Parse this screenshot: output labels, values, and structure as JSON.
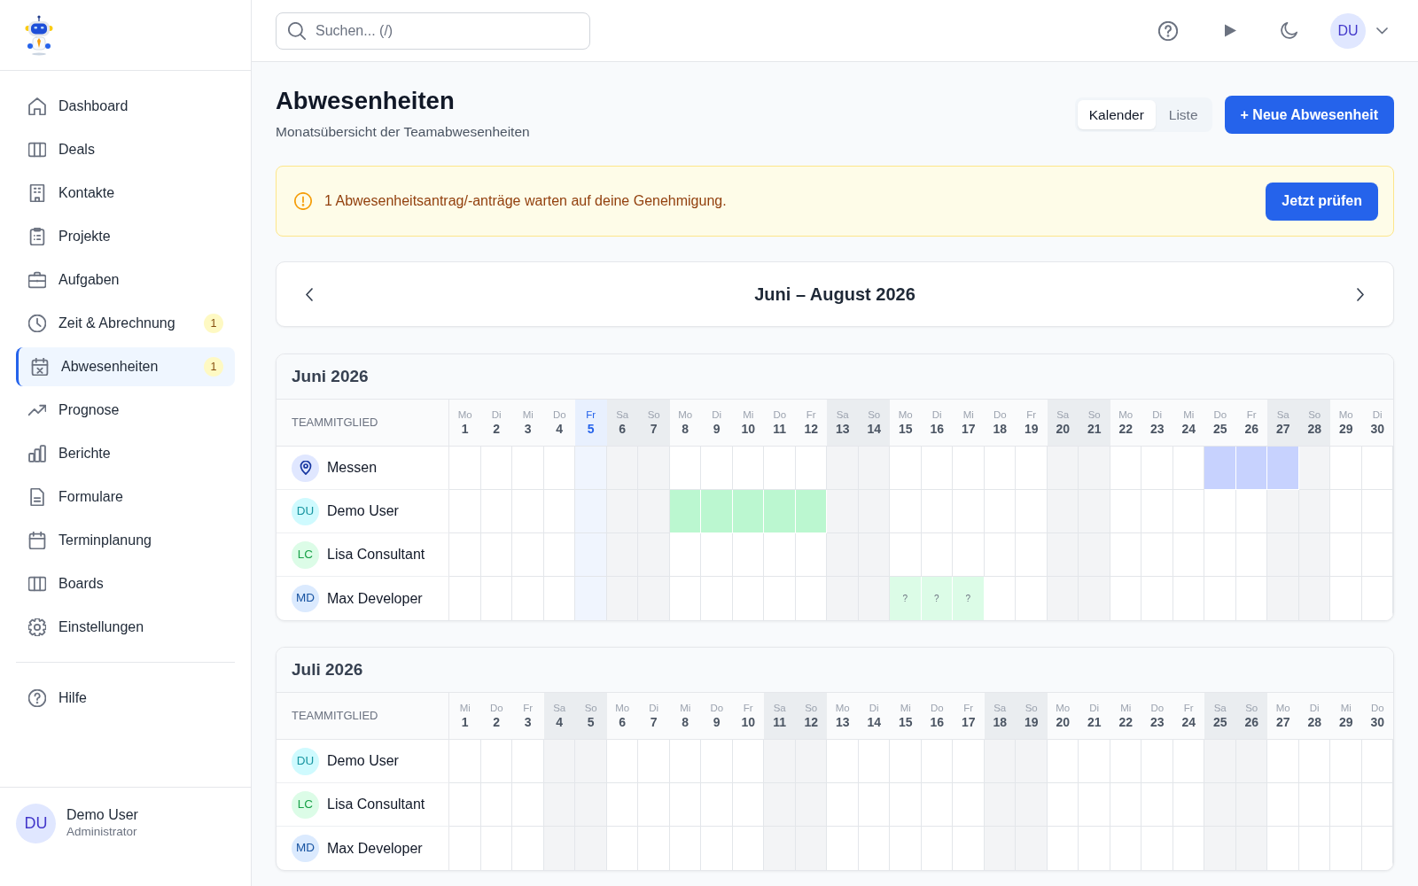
{
  "sidebar": {
    "items": [
      {
        "label": "Dashboard",
        "selected": false
      },
      {
        "label": "Deals",
        "selected": false
      },
      {
        "label": "Kontakte",
        "selected": false
      },
      {
        "label": "Projekte",
        "selected": false
      },
      {
        "label": "Aufgaben",
        "selected": false
      },
      {
        "label": "Zeit & Abrechnung",
        "selected": false,
        "badge": "1"
      },
      {
        "label": "Abwesenheiten",
        "selected": true,
        "badge": "1"
      },
      {
        "label": "Prognose",
        "selected": false
      },
      {
        "label": "Berichte",
        "selected": false
      },
      {
        "label": "Formulare",
        "selected": false
      },
      {
        "label": "Terminplanung",
        "selected": false
      },
      {
        "label": "Boards",
        "selected": false
      },
      {
        "label": "Einstellungen",
        "selected": false
      }
    ],
    "footer_items": [
      {
        "label": "Hilfe",
        "selected": false
      }
    ],
    "user": {
      "initials": "DU",
      "name": "Demo User",
      "role": "Administrator"
    }
  },
  "topbar": {
    "search": {
      "placeholder": "Suchen... (/)"
    },
    "avatar": "DU"
  },
  "header": {
    "title": "Abwesenheiten",
    "subtitle": "Monatsübersicht der Teamabwesenheiten",
    "view_toggle": [
      {
        "label": "Kalender",
        "selected": true
      },
      {
        "label": "Liste",
        "selected": false
      }
    ],
    "primary_button": "+ Neue Abwesenheit"
  },
  "alert": {
    "text": "1 Abwesenheitsantrag/-anträge warten auf deine Genehmigung.",
    "button": "Jetzt prüfen"
  },
  "period_nav": {
    "label": "Juni – August 2026"
  },
  "months": [
    {
      "title": "Juni 2026",
      "column_heading": "TEAMMITGLIED",
      "days": [
        {
          "weekday": "Mo",
          "day": "1",
          "weekend": false,
          "today": false
        },
        {
          "weekday": "Di",
          "day": "2",
          "weekend": false,
          "today": false
        },
        {
          "weekday": "Mi",
          "day": "3",
          "weekend": false,
          "today": false
        },
        {
          "weekday": "Do",
          "day": "4",
          "weekend": false,
          "today": false
        },
        {
          "weekday": "Fr",
          "day": "5",
          "weekend": false,
          "today": true
        },
        {
          "weekday": "Sa",
          "day": "6",
          "weekend": true,
          "today": false
        },
        {
          "weekday": "So",
          "day": "7",
          "weekend": true,
          "today": false
        },
        {
          "weekday": "Mo",
          "day": "8",
          "weekend": false,
          "today": false
        },
        {
          "weekday": "Di",
          "day": "9",
          "weekend": false,
          "today": false
        },
        {
          "weekday": "Mi",
          "day": "10",
          "weekend": false,
          "today": false
        },
        {
          "weekday": "Do",
          "day": "11",
          "weekend": false,
          "today": false
        },
        {
          "weekday": "Fr",
          "day": "12",
          "weekend": false,
          "today": false
        },
        {
          "weekday": "Sa",
          "day": "13",
          "weekend": true,
          "today": false
        },
        {
          "weekday": "So",
          "day": "14",
          "weekend": true,
          "today": false
        },
        {
          "weekday": "Mo",
          "day": "15",
          "weekend": false,
          "today": false
        },
        {
          "weekday": "Di",
          "day": "16",
          "weekend": false,
          "today": false
        },
        {
          "weekday": "Mi",
          "day": "17",
          "weekend": false,
          "today": false
        },
        {
          "weekday": "Do",
          "day": "18",
          "weekend": false,
          "today": false
        },
        {
          "weekday": "Fr",
          "day": "19",
          "weekend": false,
          "today": false
        },
        {
          "weekday": "Sa",
          "day": "20",
          "weekend": true,
          "today": false
        },
        {
          "weekday": "So",
          "day": "21",
          "weekend": true,
          "today": false
        },
        {
          "weekday": "Mo",
          "day": "22",
          "weekend": false,
          "today": false
        },
        {
          "weekday": "Di",
          "day": "23",
          "weekend": false,
          "today": false
        },
        {
          "weekday": "Mi",
          "day": "24",
          "weekend": false,
          "today": false
        },
        {
          "weekday": "Do",
          "day": "25",
          "weekend": false,
          "today": false
        },
        {
          "weekday": "Fr",
          "day": "26",
          "weekend": false,
          "today": false
        },
        {
          "weekday": "Sa",
          "day": "27",
          "weekend": true,
          "today": false
        },
        {
          "weekday": "So",
          "day": "28",
          "weekend": true,
          "today": false
        },
        {
          "weekday": "Mo",
          "day": "29",
          "weekend": false,
          "today": false
        },
        {
          "weekday": "Di",
          "day": "30",
          "weekend": false,
          "today": false
        }
      ],
      "members": [
        {
          "kind": "location",
          "name": "Messen",
          "color": "#e0e7ff",
          "cells": [
            {
              "absent": false
            },
            {
              "absent": false
            },
            {
              "absent": false
            },
            {
              "absent": false
            },
            {
              "absent": false
            },
            {
              "absent": false
            },
            {
              "absent": false
            },
            {
              "absent": false
            },
            {
              "absent": false
            },
            {
              "absent": false
            },
            {
              "absent": false
            },
            {
              "absent": false
            },
            {
              "absent": false
            },
            {
              "absent": false
            },
            {
              "absent": false
            },
            {
              "absent": false
            },
            {
              "absent": false
            },
            {
              "absent": false
            },
            {
              "absent": false
            },
            {
              "absent": false
            },
            {
              "absent": false
            },
            {
              "absent": false
            },
            {
              "absent": false
            },
            {
              "absent": false
            },
            {
              "absent": true,
              "color": "#c7d2fe"
            },
            {
              "absent": true,
              "color": "#c7d2fe"
            },
            {
              "absent": true,
              "color": "#c7d2fe"
            },
            {
              "absent": false
            },
            {
              "absent": false
            },
            {
              "absent": false
            }
          ]
        },
        {
          "kind": "person",
          "initials": "DU",
          "name": "Demo User",
          "color": "#cffafe",
          "cells": [
            {
              "absent": false
            },
            {
              "absent": false
            },
            {
              "absent": false
            },
            {
              "absent": false
            },
            {
              "absent": false
            },
            {
              "absent": false
            },
            {
              "absent": false
            },
            {
              "absent": true,
              "color": "#bbf7d0"
            },
            {
              "absent": true,
              "color": "#bbf7d0"
            },
            {
              "absent": true,
              "color": "#bbf7d0"
            },
            {
              "absent": true,
              "color": "#bbf7d0"
            },
            {
              "absent": true,
              "color": "#bbf7d0"
            },
            {
              "absent": false
            },
            {
              "absent": false
            },
            {
              "absent": false
            },
            {
              "absent": false
            },
            {
              "absent": false
            },
            {
              "absent": false
            },
            {
              "absent": false
            },
            {
              "absent": false
            },
            {
              "absent": false
            },
            {
              "absent": false
            },
            {
              "absent": false
            },
            {
              "absent": false
            },
            {
              "absent": false
            },
            {
              "absent": false
            },
            {
              "absent": false
            },
            {
              "absent": false
            },
            {
              "absent": false
            },
            {
              "absent": false
            }
          ]
        },
        {
          "kind": "person",
          "initials": "LC",
          "name": "Lisa Consultant",
          "color": "#dcfce7",
          "cells": [
            {
              "absent": false
            },
            {
              "absent": false
            },
            {
              "absent": false
            },
            {
              "absent": false
            },
            {
              "absent": false
            },
            {
              "absent": false
            },
            {
              "absent": false
            },
            {
              "absent": false
            },
            {
              "absent": false
            },
            {
              "absent": false
            },
            {
              "absent": false
            },
            {
              "absent": false
            },
            {
              "absent": false
            },
            {
              "absent": false
            },
            {
              "absent": false
            },
            {
              "absent": false
            },
            {
              "absent": false
            },
            {
              "absent": false
            },
            {
              "absent": false
            },
            {
              "absent": false
            },
            {
              "absent": false
            },
            {
              "absent": false
            },
            {
              "absent": false
            },
            {
              "absent": false
            },
            {
              "absent": false
            },
            {
              "absent": false
            },
            {
              "absent": false
            },
            {
              "absent": false
            },
            {
              "absent": false
            },
            {
              "absent": false
            }
          ]
        },
        {
          "kind": "person",
          "initials": "MD",
          "name": "Max Developer",
          "color": "#dbeafe",
          "cells": [
            {
              "absent": false
            },
            {
              "absent": false
            },
            {
              "absent": false
            },
            {
              "absent": false
            },
            {
              "absent": false
            },
            {
              "absent": false
            },
            {
              "absent": false
            },
            {
              "absent": false
            },
            {
              "absent": false
            },
            {
              "absent": false
            },
            {
              "absent": false
            },
            {
              "absent": false
            },
            {
              "absent": false
            },
            {
              "absent": false
            },
            {
              "absent": true,
              "color": "#dcfce7",
              "label": "?"
            },
            {
              "absent": true,
              "color": "#dcfce7",
              "label": "?"
            },
            {
              "absent": true,
              "color": "#dcfce7",
              "label": "?"
            },
            {
              "absent": false
            },
            {
              "absent": false
            },
            {
              "absent": false
            },
            {
              "absent": false
            },
            {
              "absent": false
            },
            {
              "absent": false
            },
            {
              "absent": false
            },
            {
              "absent": false
            },
            {
              "absent": false
            },
            {
              "absent": false
            },
            {
              "absent": false
            },
            {
              "absent": false
            },
            {
              "absent": false
            }
          ]
        }
      ]
    },
    {
      "title": "Juli 2026",
      "column_heading": "TEAMMITGLIED",
      "days": [
        {
          "weekday": "Mi",
          "day": "1",
          "weekend": false,
          "today": false
        },
        {
          "weekday": "Do",
          "day": "2",
          "weekend": false,
          "today": false
        },
        {
          "weekday": "Fr",
          "day": "3",
          "weekend": false,
          "today": false
        },
        {
          "weekday": "Sa",
          "day": "4",
          "weekend": true,
          "today": false
        },
        {
          "weekday": "So",
          "day": "5",
          "weekend": true,
          "today": false
        },
        {
          "weekday": "Mo",
          "day": "6",
          "weekend": false,
          "today": false
        },
        {
          "weekday": "Di",
          "day": "7",
          "weekend": false,
          "today": false
        },
        {
          "weekday": "Mi",
          "day": "8",
          "weekend": false,
          "today": false
        },
        {
          "weekday": "Do",
          "day": "9",
          "weekend": false,
          "today": false
        },
        {
          "weekday": "Fr",
          "day": "10",
          "weekend": false,
          "today": false
        },
        {
          "weekday": "Sa",
          "day": "11",
          "weekend": true,
          "today": false
        },
        {
          "weekday": "So",
          "day": "12",
          "weekend": true,
          "today": false
        },
        {
          "weekday": "Mo",
          "day": "13",
          "weekend": false,
          "today": false
        },
        {
          "weekday": "Di",
          "day": "14",
          "weekend": false,
          "today": false
        },
        {
          "weekday": "Mi",
          "day": "15",
          "weekend": false,
          "today": false
        },
        {
          "weekday": "Do",
          "day": "16",
          "weekend": false,
          "today": false
        },
        {
          "weekday": "Fr",
          "day": "17",
          "weekend": false,
          "today": false
        },
        {
          "weekday": "Sa",
          "day": "18",
          "weekend": true,
          "today": false
        },
        {
          "weekday": "So",
          "day": "19",
          "weekend": true,
          "today": false
        },
        {
          "weekday": "Mo",
          "day": "20",
          "weekend": false,
          "today": false
        },
        {
          "weekday": "Di",
          "day": "21",
          "weekend": false,
          "today": false
        },
        {
          "weekday": "Mi",
          "day": "22",
          "weekend": false,
          "today": false
        },
        {
          "weekday": "Do",
          "day": "23",
          "weekend": false,
          "today": false
        },
        {
          "weekday": "Fr",
          "day": "24",
          "weekend": false,
          "today": false
        },
        {
          "weekday": "Sa",
          "day": "25",
          "weekend": true,
          "today": false
        },
        {
          "weekday": "So",
          "day": "26",
          "weekend": true,
          "today": false
        },
        {
          "weekday": "Mo",
          "day": "27",
          "weekend": false,
          "today": false
        },
        {
          "weekday": "Di",
          "day": "28",
          "weekend": false,
          "today": false
        },
        {
          "weekday": "Mi",
          "day": "29",
          "weekend": false,
          "today": false
        },
        {
          "weekday": "Do",
          "day": "30",
          "weekend": false,
          "today": false
        }
      ],
      "members": [
        {
          "kind": "person",
          "initials": "DU",
          "name": "Demo User",
          "color": "#cffafe",
          "cells": [
            {
              "absent": false
            },
            {
              "absent": false
            },
            {
              "absent": false
            },
            {
              "absent": false
            },
            {
              "absent": false
            },
            {
              "absent": false
            },
            {
              "absent": false
            },
            {
              "absent": false
            },
            {
              "absent": false
            },
            {
              "absent": false
            },
            {
              "absent": false
            },
            {
              "absent": false
            },
            {
              "absent": false
            },
            {
              "absent": false
            },
            {
              "absent": false
            },
            {
              "absent": false
            },
            {
              "absent": false
            },
            {
              "absent": false
            },
            {
              "absent": false
            },
            {
              "absent": false
            },
            {
              "absent": false
            },
            {
              "absent": false
            },
            {
              "absent": false
            },
            {
              "absent": false
            },
            {
              "absent": false
            },
            {
              "absent": false
            },
            {
              "absent": false
            },
            {
              "absent": false
            },
            {
              "absent": false
            },
            {
              "absent": false
            }
          ]
        },
        {
          "kind": "person",
          "initials": "LC",
          "name": "Lisa Consultant",
          "color": "#dcfce7",
          "cells": [
            {
              "absent": false
            },
            {
              "absent": false
            },
            {
              "absent": false
            },
            {
              "absent": false
            },
            {
              "absent": false
            },
            {
              "absent": false
            },
            {
              "absent": false
            },
            {
              "absent": false
            },
            {
              "absent": false
            },
            {
              "absent": false
            },
            {
              "absent": false
            },
            {
              "absent": false
            },
            {
              "absent": false
            },
            {
              "absent": false
            },
            {
              "absent": false
            },
            {
              "absent": false
            },
            {
              "absent": false
            },
            {
              "absent": false
            },
            {
              "absent": false
            },
            {
              "absent": false
            },
            {
              "absent": false
            },
            {
              "absent": false
            },
            {
              "absent": false
            },
            {
              "absent": false
            },
            {
              "absent": false
            },
            {
              "absent": false
            },
            {
              "absent": false
            },
            {
              "absent": false
            },
            {
              "absent": false
            },
            {
              "absent": false
            }
          ]
        },
        {
          "kind": "person",
          "initials": "MD",
          "name": "Max Developer",
          "color": "#dbeafe",
          "cells": [
            {
              "absent": false
            },
            {
              "absent": false
            },
            {
              "absent": false
            },
            {
              "absent": false
            },
            {
              "absent": false
            },
            {
              "absent": false
            },
            {
              "absent": false
            },
            {
              "absent": false
            },
            {
              "absent": false
            },
            {
              "absent": false
            },
            {
              "absent": false
            },
            {
              "absent": false
            },
            {
              "absent": false
            },
            {
              "absent": false
            },
            {
              "absent": false
            },
            {
              "absent": false
            },
            {
              "absent": false
            },
            {
              "absent": false
            },
            {
              "absent": false
            },
            {
              "absent": false
            },
            {
              "absent": false
            },
            {
              "absent": false
            },
            {
              "absent": false
            },
            {
              "absent": false
            },
            {
              "absent": false
            },
            {
              "absent": false
            },
            {
              "absent": false
            },
            {
              "absent": false
            },
            {
              "absent": false
            },
            {
              "absent": false
            }
          ]
        }
      ]
    }
  ]
}
